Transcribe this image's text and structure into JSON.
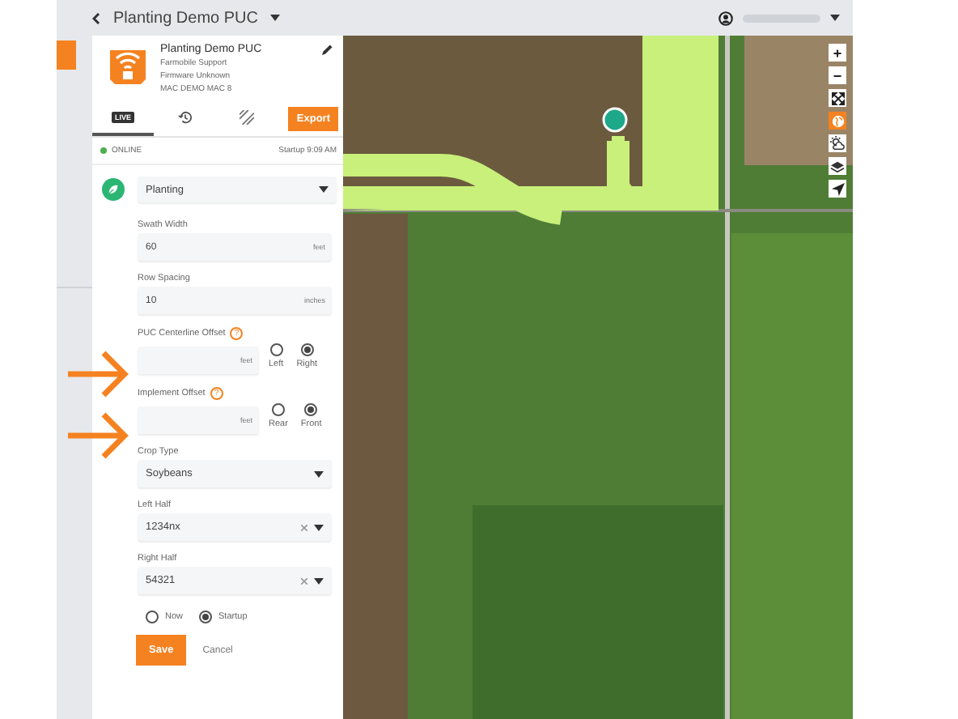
{
  "top_bar": {
    "title": "Planting Demo PUC"
  },
  "device": {
    "name": "Planting Demo PUC",
    "lines": [
      "Farmobile Support",
      "Firmware Unknown",
      "MAC DEMO MAC 8"
    ]
  },
  "tabs": [
    {
      "kind": "live",
      "label": "LIVE",
      "selected": true
    },
    {
      "kind": "history",
      "selected": false
    },
    {
      "kind": "coverage",
      "selected": false
    }
  ],
  "export_button": "Export",
  "status": {
    "online": true,
    "label": "ONLINE",
    "startup": "Startup 9:09 AM"
  },
  "operation": {
    "value": "Planting"
  },
  "fields": [
    {
      "kind": "input",
      "label": "Swath Width",
      "value": "60",
      "unit": "feet"
    },
    {
      "kind": "input",
      "label": "Row Spacing",
      "value": "10",
      "unit": "inches"
    },
    {
      "kind": "offset",
      "label": "PUC Centerline Offset",
      "help": "?",
      "unit": "feet",
      "options": [
        {
          "label": "Left",
          "selected": false
        },
        {
          "label": "Right",
          "selected": true
        }
      ]
    },
    {
      "kind": "offset",
      "label": "Implement Offset",
      "help": "?",
      "unit": "feet",
      "options": [
        {
          "label": "Rear",
          "selected": false
        },
        {
          "label": "Front",
          "selected": true
        }
      ]
    },
    {
      "kind": "select",
      "label": "Crop Type",
      "value": "Soybeans",
      "clearable": false
    },
    {
      "kind": "select",
      "label": "Left Half",
      "value": "1234nx",
      "clearable": true
    },
    {
      "kind": "select",
      "label": "Right Half",
      "value": "54321",
      "clearable": true
    }
  ],
  "apply": [
    {
      "label": "Now",
      "selected": false
    },
    {
      "label": "Startup",
      "selected": true
    }
  ],
  "save_button": "Save",
  "cancel_button": "Cancel",
  "map_controls": [
    {
      "kind": "text",
      "label": "+",
      "active": false
    },
    {
      "kind": "text",
      "label": "−",
      "active": false
    },
    {
      "kind": "fullscreen",
      "active": false
    },
    {
      "kind": "globe",
      "active": true
    },
    {
      "kind": "weather",
      "active": false
    },
    {
      "kind": "layers",
      "active": false
    },
    {
      "kind": "locate",
      "active": false
    }
  ]
}
